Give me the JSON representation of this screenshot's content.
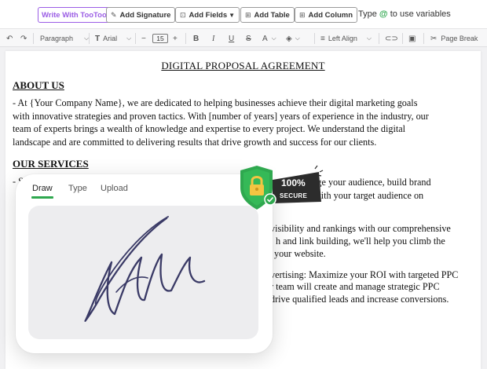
{
  "toolbar": {
    "write_ai": "Write With TooToo",
    "add_signature": "Add Signature",
    "add_fields": "Add Fields",
    "add_table": "Add Table",
    "add_column": "Add Column",
    "variable_hint": {
      "prefix": "Type",
      "symbol": "@",
      "suffix": "to use variables"
    }
  },
  "format": {
    "paragraph": "Paragraph",
    "font": "Arial",
    "font_size": "15",
    "align": "Left Align",
    "page_break": "Page Break"
  },
  "document": {
    "title": "DIGITAL PROPOSAL AGREEMENT",
    "about_heading": "ABOUT US",
    "about_lines": [
      "- At {Your Company Name}, we are dedicated to helping businesses achieve their digital marketing goals",
      "with innovative strategies and proven tactics. With [number of years] years of experience in the industry, our",
      "team of experts brings a wealth of knowledge and expertise to every project. We understand the digital",
      "landscape and are committed to delivering results that drive growth and success for our clients."
    ],
    "services_heading": "OUR SERVICES",
    "services_bullet": "- S",
    "visible_fragments": [
      "age your audience, build brand",
      "connect with your target audience on",
      "visibility and rankings with our comprehensive",
      "h and link building, we'll help you climb the",
      "your website.",
      "vertising: Maximize your ROI with targeted PPC",
      "r team will create and manage strategic PPC",
      "drive qualified leads and increase conversions."
    ]
  },
  "signature_panel": {
    "tabs": [
      "Draw",
      "Type",
      "Upload"
    ],
    "active_tab": "Draw",
    "accent": "#2fa84f",
    "ink_color": "#3a3a66"
  },
  "security_badge": {
    "percent": "100%",
    "label": "SECURE",
    "shield_color": "#2fa84f",
    "ribbon_color": "#2c2c2c"
  },
  "icons": [
    "undo-icon",
    "redo-icon",
    "text-icon",
    "bold-icon",
    "italic-icon",
    "underline-icon",
    "strikethrough-icon",
    "font-color-icon",
    "highlight-icon",
    "align-icon",
    "link-icon",
    "image-icon",
    "scissors-icon",
    "lock-icon"
  ]
}
